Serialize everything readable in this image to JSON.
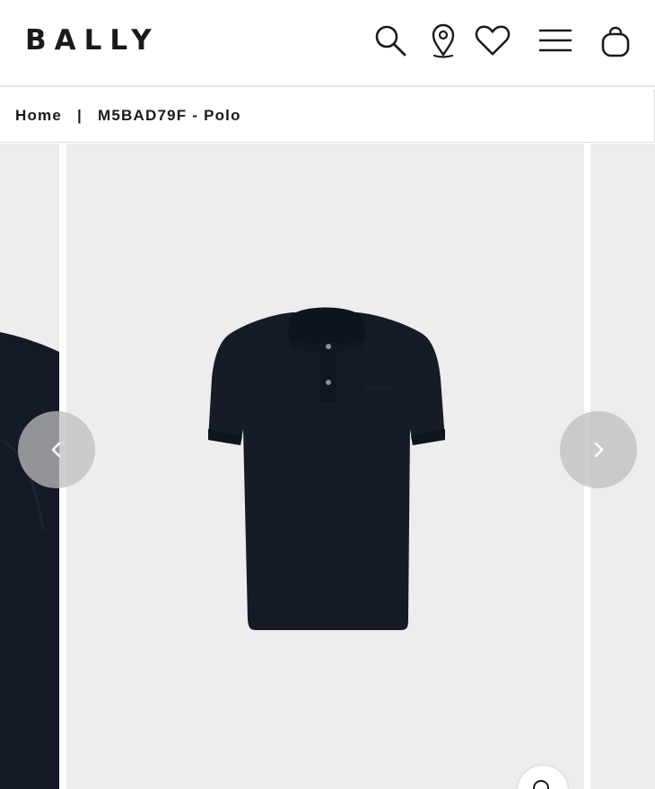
{
  "header": {
    "logo": "BALLY",
    "icons": [
      "search-icon",
      "store-locator-icon",
      "wishlist-heart-icon",
      "menu-icon",
      "shopping-bag-icon"
    ]
  },
  "breadcrumb": {
    "home": "Home",
    "separator": "|",
    "current": "M5BAD79F - Polo"
  },
  "gallery": {
    "product": "navy polo shirt",
    "background_color": "#ededed",
    "product_color": "#151c28",
    "controls": [
      "chevron-left-icon",
      "chevron-right-icon",
      "zoom-icon"
    ]
  }
}
